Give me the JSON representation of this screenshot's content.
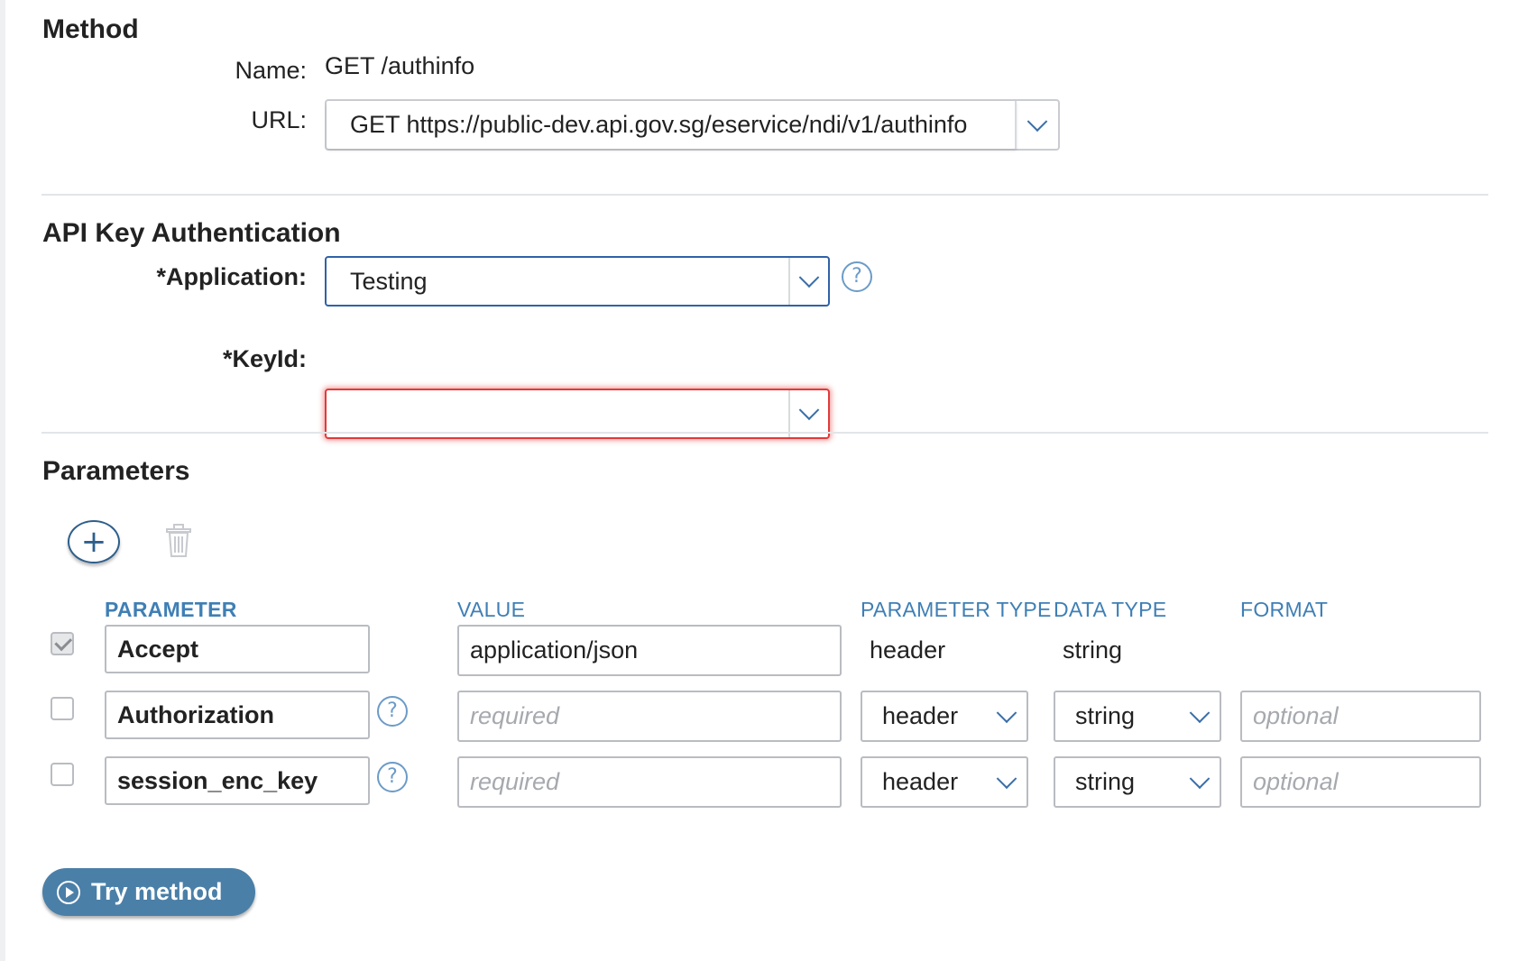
{
  "method": {
    "title": "Method",
    "name_label": "Name:",
    "name_value": "GET /authinfo",
    "url_label": "URL:",
    "url_value": "GET https://public-dev.api.gov.sg/eservice/ndi/v1/authinfo"
  },
  "auth": {
    "title": "API Key Authentication",
    "application_label": "*Application:",
    "application_value": "Testing",
    "keyid_label": "*KeyId:",
    "keyid_value": "",
    "keyid_state": "error",
    "error_color": "#e23a3a",
    "focus_color": "#2f62a8"
  },
  "parameters": {
    "title": "Parameters",
    "add_icon": "plus-circle-icon",
    "delete_icon": "trash-icon",
    "headers": {
      "parameter": "PARAMETER",
      "value": "VALUE",
      "parameter_type": "PARAMETER TYPE",
      "data_type": "DATA TYPE",
      "format": "FORMAT"
    },
    "rows": [
      {
        "checked": true,
        "disabled": true,
        "name": "Accept",
        "value": "application/json",
        "value_placeholder": "",
        "parameter_type": "header",
        "data_type": "string",
        "format_placeholder": ""
      },
      {
        "checked": false,
        "disabled": false,
        "name": "Authorization",
        "value": "",
        "value_placeholder": "required",
        "parameter_type": "header",
        "data_type": "string",
        "format_placeholder": "optional"
      },
      {
        "checked": false,
        "disabled": false,
        "name": "session_enc_key",
        "value": "",
        "value_placeholder": "required",
        "parameter_type": "header",
        "data_type": "string",
        "format_placeholder": "optional"
      }
    ]
  },
  "try_button": {
    "label": "Try method",
    "icon": "play-circle-icon",
    "color": "#4a7fa8"
  },
  "colors": {
    "accent": "#3f7fb5",
    "divider": "#e3e5e8"
  }
}
